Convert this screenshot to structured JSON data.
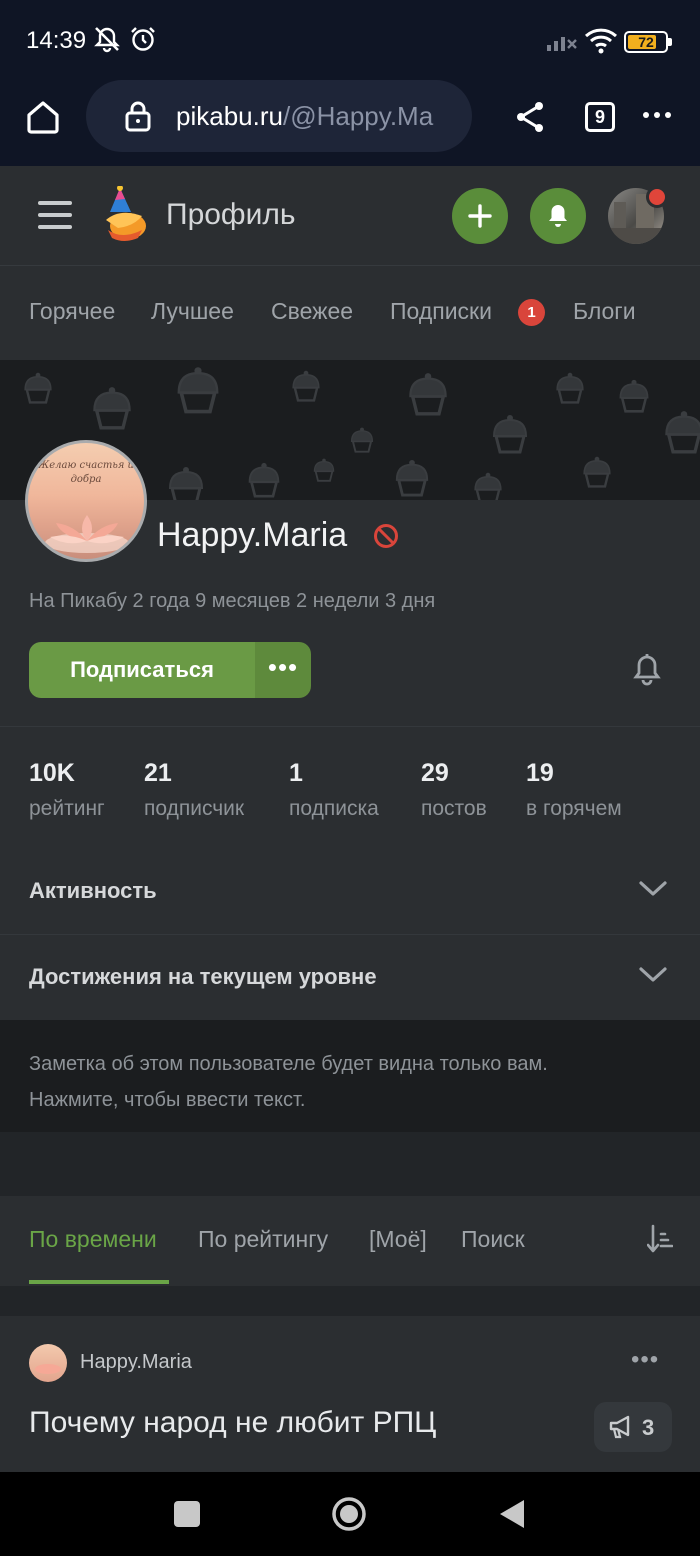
{
  "status_bar": {
    "time": "14:39",
    "battery": "72",
    "icons": [
      "mute-icon",
      "alarm-icon",
      "signal-icon",
      "wifi-icon",
      "battery-icon"
    ]
  },
  "browser": {
    "url_host": "pikabu.ru",
    "url_path": "/@Happy.Ma",
    "tab_count": "9",
    "icons": [
      "home-icon",
      "lock-icon",
      "share-icon",
      "tabs-icon",
      "more-icon"
    ]
  },
  "header": {
    "title": "Профиль",
    "icons": [
      "menu-icon",
      "pikabu-logo-icon",
      "plus-icon",
      "bell-icon",
      "avatar"
    ]
  },
  "nav_tabs": {
    "items": [
      {
        "label": "Горячее"
      },
      {
        "label": "Лучшее"
      },
      {
        "label": "Свежее"
      },
      {
        "label": "Подписки"
      },
      {
        "label": "Блоги"
      }
    ],
    "subscriptions_badge": "1"
  },
  "profile": {
    "avatar_text": "Желаю счастья и добра",
    "username": "Happy.Maria",
    "since": "На Пикабу 2 года 9 месяцев 2 недели 3 дня",
    "subscribe_label": "Подписаться",
    "more_label": "•••"
  },
  "stats": [
    {
      "value": "10K",
      "label": "рейтинг"
    },
    {
      "value": "21",
      "label": "подписчик"
    },
    {
      "value": "1",
      "label": "подписка"
    },
    {
      "value": "29",
      "label": "постов"
    },
    {
      "value": "19",
      "label": "в горячем"
    }
  ],
  "sections": {
    "activity": "Активность",
    "achievements": "Достижения на текущем уровне"
  },
  "note": {
    "line1": "Заметка об этом пользователе будет видна только вам.",
    "line2": "Нажмите, чтобы ввести текст."
  },
  "sort_tabs": {
    "items": [
      {
        "label": "По времени"
      },
      {
        "label": "По рейтингу"
      },
      {
        "label": "[Моё]"
      },
      {
        "label": "Поиск"
      }
    ],
    "active_index": 0
  },
  "post": {
    "author": "Happy.Maria",
    "title": "Почему народ не любит РПЦ",
    "comment_count": "3",
    "more_label": "•••"
  },
  "colors": {
    "accent_green": "#6aa547",
    "button_green": "#6a9a45",
    "badge_red": "#d9453b",
    "background": "#222528",
    "card": "#2b2e31"
  }
}
